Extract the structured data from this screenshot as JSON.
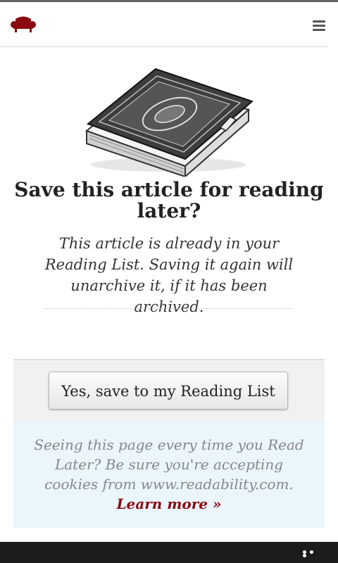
{
  "header": {
    "logo_icon": "armchair-icon",
    "menu_icon": "hamburger-menu-icon"
  },
  "main": {
    "illustration": "book-icon",
    "title": "Save this article for reading later?",
    "subtitle": "This article is already in your Reading List. Saving it again will unarchive it, if it has been archived."
  },
  "actions": {
    "save_label": "Yes, save to my Reading List"
  },
  "notice": {
    "text": "Seeing this page every time you Read Later? Be sure you're accepting cookies from www.readability.com.",
    "link_label": "Learn more »"
  },
  "bottom_bar": {
    "more_icon": "more-dots-icon"
  },
  "colors": {
    "brand": "#8b0a12",
    "notice_bg": "#eaf5fc",
    "panel_bg": "#f1f1f1"
  }
}
